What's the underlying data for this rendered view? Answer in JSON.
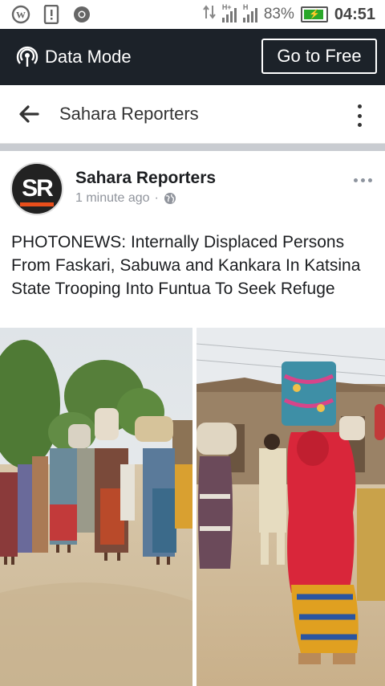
{
  "status_bar": {
    "icons": [
      "wordpress-icon",
      "notification-icon",
      "chrome-icon"
    ],
    "network_labels": [
      "H+",
      "H"
    ],
    "battery": "83%",
    "time": "04:51"
  },
  "data_mode": {
    "label": "Data Mode",
    "button": "Go to Free"
  },
  "navbar": {
    "title": "Sahara Reporters"
  },
  "post": {
    "avatar_text": "SR",
    "author": "Sahara Reporters",
    "time": "1 minute ago",
    "separator": "·",
    "text": "PHOTONEWS: Internally Displaced Persons From Faskari, Sabuwa and Kankara In Katsina State Trooping Into Funtua To Seek Refuge"
  },
  "colors": {
    "data_mode_bg": "#1c2229",
    "divider": "#c9ccd1",
    "avatar_accent": "#e94e1b",
    "battery_fill": "#2aa82a"
  }
}
